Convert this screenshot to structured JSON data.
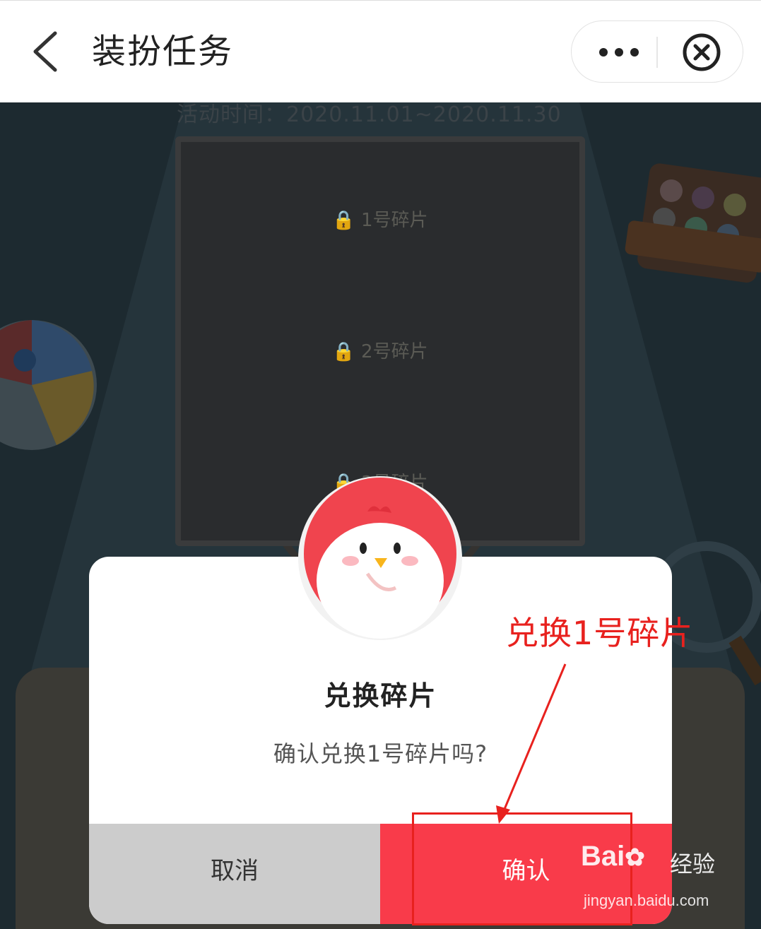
{
  "header": {
    "title": "装扮任务",
    "back_icon": "chevron-left-icon",
    "more_icon": "more-dots-icon",
    "close_icon": "close-circle-icon"
  },
  "background": {
    "date_text": "活动时间：2020.11.01~2020.11.30",
    "puzzle_pieces": [
      {
        "label": "1号碎片",
        "locked": true
      },
      {
        "label": "2号碎片",
        "locked": true
      },
      {
        "label": "3号碎片",
        "locked": true
      }
    ]
  },
  "dialog": {
    "title": "兑换碎片",
    "message": "确认兑换1号碎片吗?",
    "cancel_label": "取消",
    "confirm_label": "确认",
    "avatar_icon": "chicken-mascot-icon"
  },
  "annotation": {
    "text": "兑换1号碎片",
    "color": "#e8211e"
  },
  "watermark": {
    "logo_text": "Bai",
    "cn_text": "经验",
    "url": "jingyan.baidu.com"
  },
  "colors": {
    "confirm_bg": "#f93b4a",
    "cancel_bg": "#cccccc",
    "overlay_bg": "#1d2a30"
  }
}
